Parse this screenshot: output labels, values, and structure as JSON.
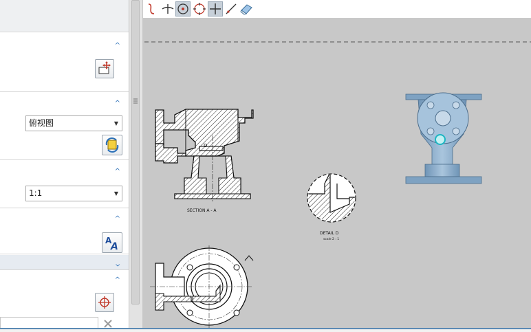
{
  "left_panel": {
    "view_combo": {
      "value": "俯视图"
    },
    "scale_combo": {
      "value": "1:1"
    }
  },
  "drawing": {
    "section_label": "SECTION  A - A",
    "detail_marker": "D",
    "detail_label": "DETAIL  D",
    "detail_scale": "scale 2 : 1"
  },
  "colors": {
    "canvas_bg": "#c8c8c8",
    "accent": "#2a6fb7",
    "model_blue": "#8fb2cf"
  },
  "icons": {
    "toolbar": [
      "curve-tool-icon",
      "perpendicular-tool-icon",
      "circle-center-icon",
      "circle-quadrant-icon",
      "crosshair-icon",
      "line-tool-icon",
      "eraser-icon"
    ],
    "panel": [
      "move-view-icon",
      "refresh-view-icon",
      "text-style-icon",
      "origin-point-icon",
      "clear-icon"
    ]
  }
}
